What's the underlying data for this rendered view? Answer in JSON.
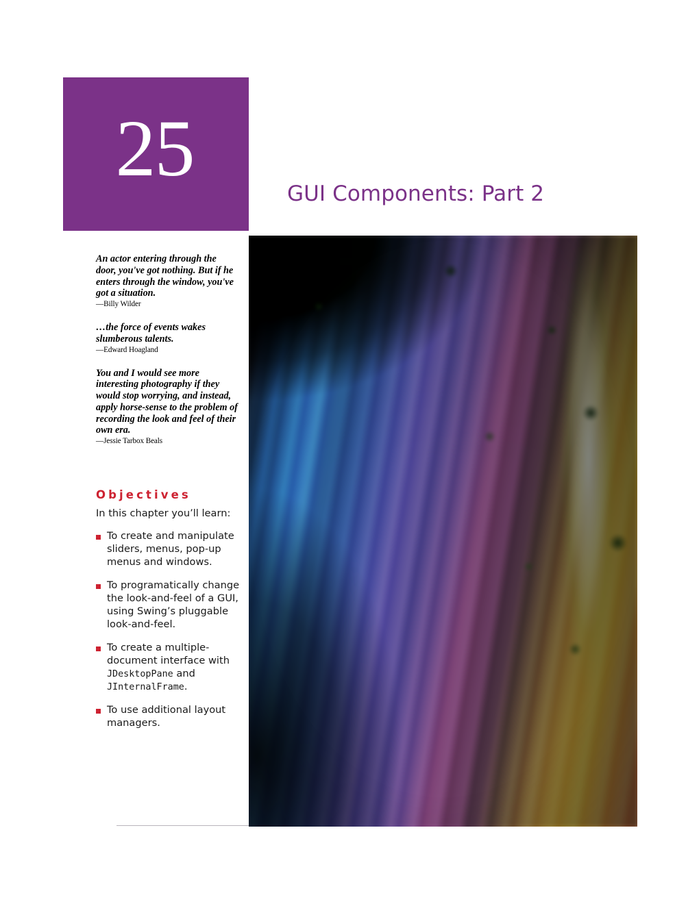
{
  "page": {
    "chapter_number": "25",
    "chapter_title": "GUI Components: Part 2",
    "accent_purple": "#7b3288",
    "accent_red": "#cd2231"
  },
  "quotes": [
    {
      "text": "An actor entering through the door, you've got nothing. But if he enters through the window, you've got a situation.",
      "attribution": "—Billy Wilder"
    },
    {
      "text": "…the force of events wakes slumberous talents.",
      "attribution": "—Edward Hoagland"
    },
    {
      "text": "You and I would see more interesting photography if they would stop worrying, and instead, apply horse-sense to the problem of recording the look and feel of their own era.",
      "attribution": "—Jessie Tarbox Beals"
    }
  ],
  "objectives": {
    "heading": "Objectives",
    "intro": "In this chapter you’ll learn:",
    "items": [
      {
        "prefix": "To create and manipulate sliders, menus, pop-up menus and windows.",
        "code1": "",
        "middle": "",
        "code2": "",
        "suffix": ""
      },
      {
        "prefix": "To programatically change the look-and-feel of a GUI, using Swing’s pluggable look-and-feel.",
        "code1": "",
        "middle": "",
        "code2": "",
        "suffix": ""
      },
      {
        "prefix": "To create a multiple-document interface with ",
        "code1": "JDesktopPane",
        "middle": " and ",
        "code2": "JInternalFrame",
        "suffix": "."
      },
      {
        "prefix": "To use additional layout managers.",
        "code1": "",
        "middle": "",
        "code2": "",
        "suffix": ""
      }
    ]
  },
  "photo": {
    "caption": "Illuminated waterfall at night with colored floodlights"
  }
}
